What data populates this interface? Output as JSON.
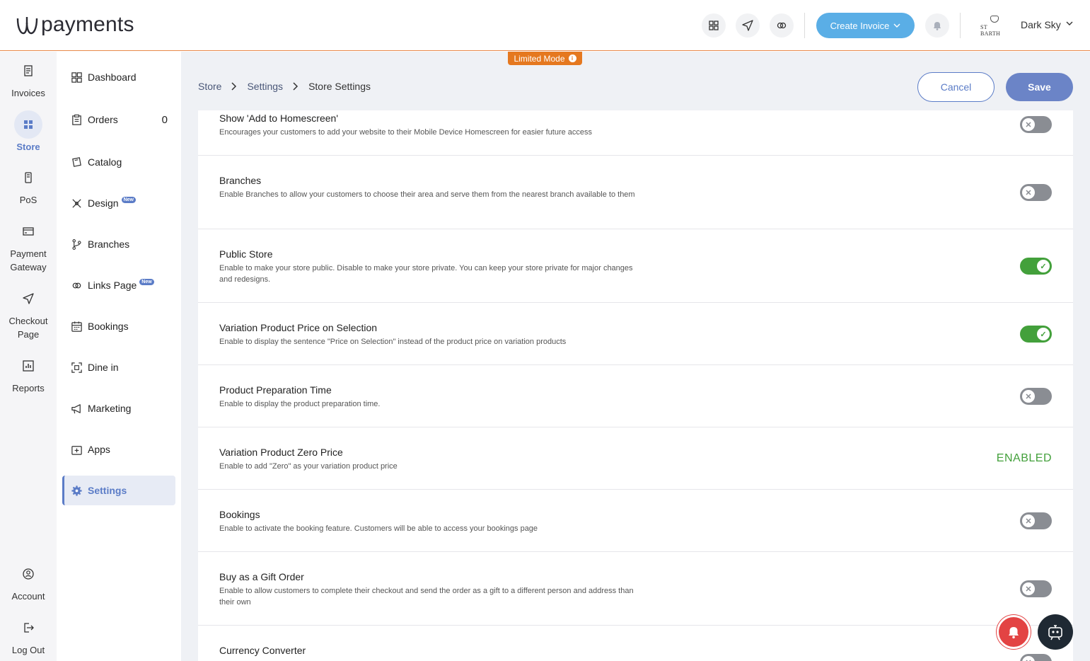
{
  "app": {
    "logo_text": "payments",
    "create_invoice_label": "Create Invoice",
    "user_name": "Dark Sky",
    "brand_logo_text": "ST BARTH"
  },
  "rail": {
    "items": [
      {
        "label": "Invoices",
        "icon": "invoice-icon"
      },
      {
        "label": "Store",
        "icon": "store-icon",
        "active": true
      },
      {
        "label": "PoS",
        "icon": "pos-icon"
      },
      {
        "label": "Payment Gateway",
        "icon": "payment-gateway-icon"
      },
      {
        "label": "Checkout Page",
        "icon": "send-icon"
      },
      {
        "label": "Reports",
        "icon": "reports-icon"
      },
      {
        "label": "Account",
        "icon": "account-icon"
      },
      {
        "label": "Log Out",
        "icon": "logout-icon"
      }
    ]
  },
  "subnav": {
    "items": [
      {
        "label": "Dashboard",
        "icon": "dashboard-icon"
      },
      {
        "label": "Orders",
        "icon": "orders-icon",
        "count": "0"
      },
      {
        "label": "Catalog",
        "icon": "catalog-icon"
      },
      {
        "label": "Design",
        "icon": "design-icon",
        "badge": "New"
      },
      {
        "label": "Branches",
        "icon": "branches-icon"
      },
      {
        "label": "Links Page",
        "icon": "links-icon",
        "badge": "New"
      },
      {
        "label": "Bookings",
        "icon": "calendar-icon"
      },
      {
        "label": "Dine in",
        "icon": "qr-icon"
      },
      {
        "label": "Marketing",
        "icon": "megaphone-icon"
      },
      {
        "label": "Apps",
        "icon": "apps-icon"
      },
      {
        "label": "Settings",
        "icon": "gear-icon",
        "active": true
      }
    ]
  },
  "main": {
    "limited_mode": "Limited Mode",
    "breadcrumb": [
      "Store",
      "Settings",
      "Store Settings"
    ],
    "cancel_label": "Cancel",
    "save_label": "Save",
    "settings": [
      {
        "title": "Show 'Add to Homescreen'",
        "desc": "Encourages your customers to add your website to their Mobile Device Homescreen for easier future access",
        "state": "off"
      },
      {
        "title": "Branches",
        "desc": "Enable Branches to allow your customers to choose their area and serve them from the nearest branch available to them",
        "state": "off"
      },
      {
        "title": "Public Store",
        "desc": "Enable to make your store public. Disable to make your store private. You can keep your store private for major changes and redesigns.",
        "state": "on"
      },
      {
        "title": "Variation Product Price on Selection",
        "desc": "Enable to display the sentence \"Price on Selection\" instead of the product price on variation products",
        "state": "on"
      },
      {
        "title": "Product Preparation Time",
        "desc": "Enable to display the product preparation time.",
        "state": "off"
      },
      {
        "title": "Variation Product Zero Price",
        "desc": "Enable to add \"Zero\" as your variation product price",
        "state": "text",
        "state_text": "ENABLED"
      },
      {
        "title": "Bookings",
        "desc": "Enable to activate the booking feature. Customers will be able to access your bookings page",
        "state": "off"
      },
      {
        "title": "Buy as a Gift Order",
        "desc": "Enable to allow customers to complete their checkout and send the order as a gift to a different person and address than their own",
        "state": "off"
      },
      {
        "title": "Currency Converter",
        "desc": "",
        "state": "off"
      }
    ]
  },
  "colors": {
    "accent": "#5b7cc7",
    "header_border": "#e8894a",
    "toggle_on": "#43a03b",
    "toggle_off": "#8a8d93",
    "create_button": "#5aaee6",
    "limited_badge": "#e5781f"
  }
}
